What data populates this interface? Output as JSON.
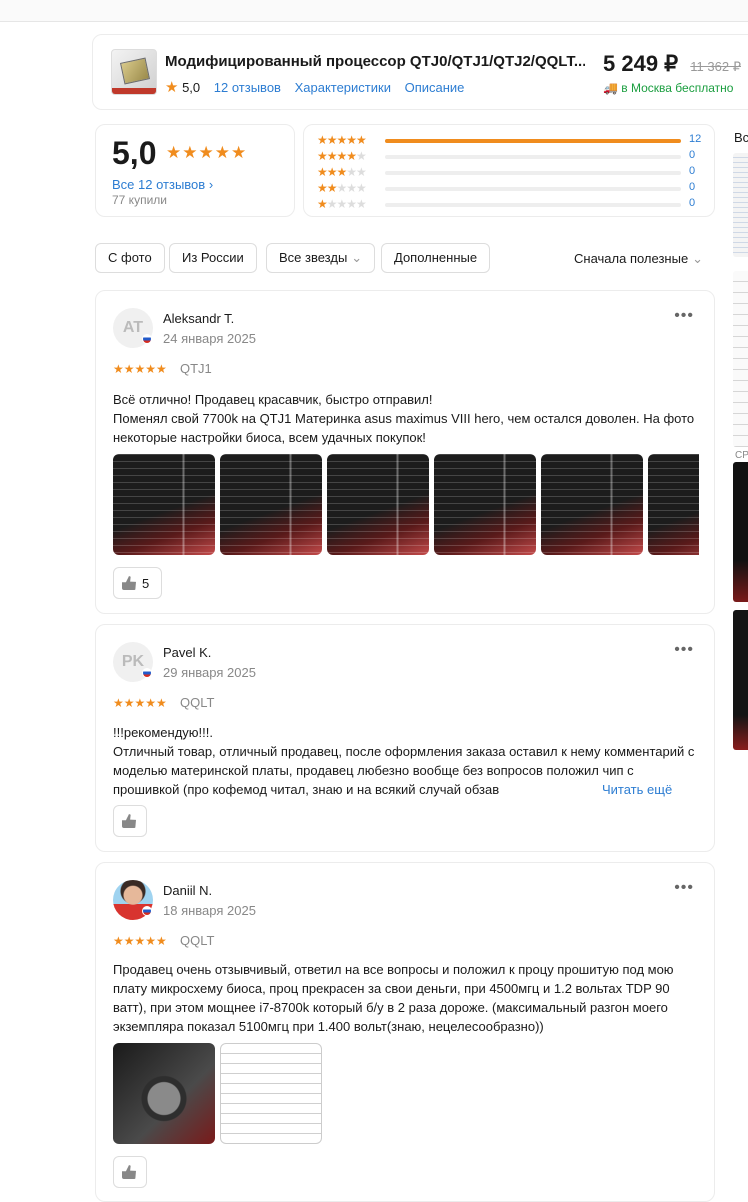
{
  "product": {
    "title": "Модифицированный процессор QTJ0/QTJ1/QTJ2/QQLT...",
    "rating": "5,0",
    "reviews_link": "12 отзывов",
    "specs_link": "Характеристики",
    "desc_link": "Описание",
    "price": "5 249 ₽",
    "old_price": "11 362 ₽",
    "delivery": "в Москва бесплатно"
  },
  "summary": {
    "rating": "5,0",
    "all_reviews": "Все 12 отзывов",
    "bought": "77 купили"
  },
  "distribution": [
    {
      "stars": 5,
      "count": "12",
      "fraction": 1.0
    },
    {
      "stars": 4,
      "count": "0",
      "fraction": 0
    },
    {
      "stars": 3,
      "count": "0",
      "fraction": 0
    },
    {
      "stars": 2,
      "count": "0",
      "fraction": 0
    },
    {
      "stars": 1,
      "count": "0",
      "fraction": 0
    }
  ],
  "filters": {
    "with_photo": "С фото",
    "from_russia": "Из России",
    "all_stars": "Все звезды",
    "supplemented": "Дополненные",
    "sort": "Сначала полезные"
  },
  "reviews": [
    {
      "initials": "AT",
      "name": "Aleksandr T.",
      "date": "24 января 2025",
      "variant": "QTJ1",
      "text": "Всё отлично! Продавец красавчик, быстро отправил!\nПоменял свой 7700k на QTJ1 Материнка asus maximus VIII hero, чем остался доволен. На фото некоторые настройки биоса, всем удачных покупок!",
      "likes": "5"
    },
    {
      "initials": "PK",
      "name": "Pavel K.",
      "date": "29 января 2025",
      "variant": "QQLT",
      "text": "!!!рекомендую!!!.\nОтличный товар, отличный продавец, после оформления заказа оставил к нему комментарий с моделью материнской платы, продавец любезно вообще  без вопросов положил чип с прошивкой (про кофемод читал, знаю и на всякий случай обзав",
      "read_more": "Читать ещё"
    },
    {
      "name": "Daniil N.",
      "date": "18 января 2025",
      "variant": "QQLT",
      "text": "Продавец очень отзывчивый, ответил на все вопросы и положил к процу прошитую под мою плату микросхему биоса, проц прекрасен за свои деньги, при 4500мгц и 1.2 вольтах TDP 90 ватт), при этом мощнее i7-8700k который б/у в 2 раза дороже. (максимальный разгон моего экземпляра показал 5100мгц при 1.400 вольт(знаю, нецелесообразно))"
    }
  ],
  "side": {
    "heading": "Вс",
    "label": "CPL"
  }
}
